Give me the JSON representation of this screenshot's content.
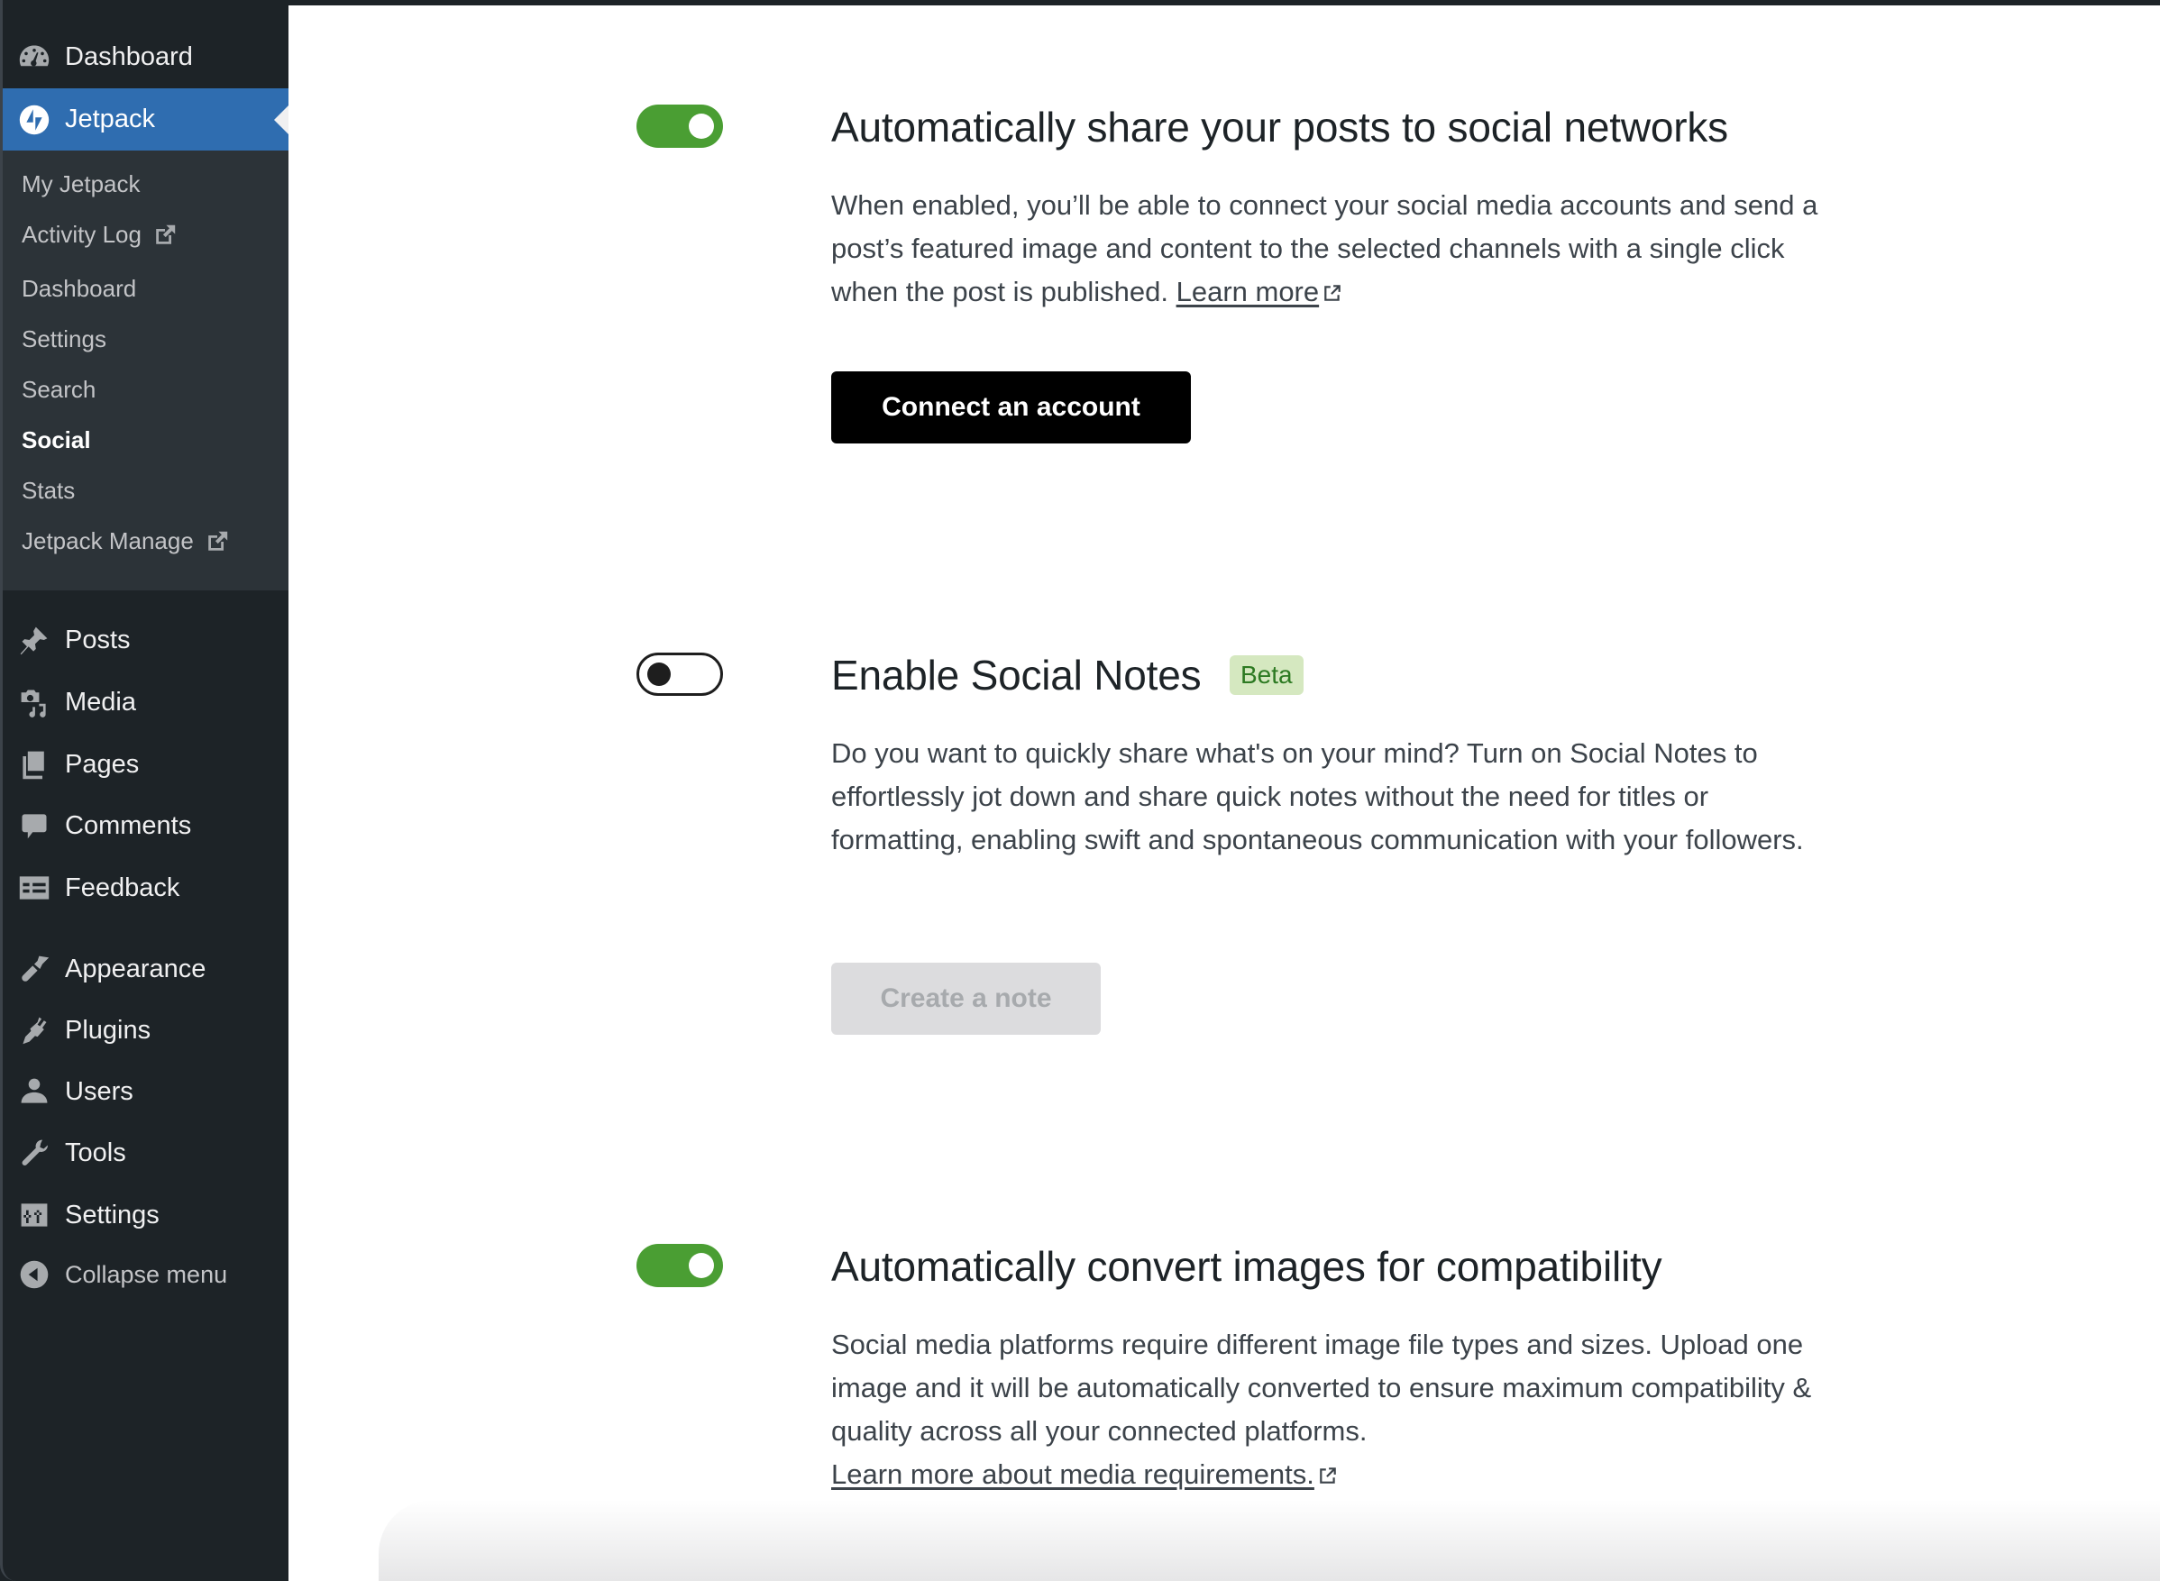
{
  "sidebar": {
    "top_items": [
      {
        "label": "Dashboard",
        "icon": "dashboard-icon"
      },
      {
        "label": "Jetpack",
        "icon": "jetpack-icon",
        "active": true
      }
    ],
    "submenu": [
      {
        "label": "My Jetpack"
      },
      {
        "label": "Activity Log",
        "external": true
      },
      {
        "label": "Dashboard"
      },
      {
        "label": "Settings"
      },
      {
        "label": "Search"
      },
      {
        "label": "Social",
        "current": true
      },
      {
        "label": "Stats"
      },
      {
        "label": "Jetpack Manage",
        "external": true
      }
    ],
    "items": [
      {
        "label": "Posts",
        "icon": "pin-icon"
      },
      {
        "label": "Media",
        "icon": "media-icon"
      },
      {
        "label": "Pages",
        "icon": "pages-icon"
      },
      {
        "label": "Comments",
        "icon": "comment-icon"
      },
      {
        "label": "Feedback",
        "icon": "feedback-icon"
      },
      {
        "label": "Appearance",
        "icon": "paintbrush-icon"
      },
      {
        "label": "Plugins",
        "icon": "plug-icon"
      },
      {
        "label": "Users",
        "icon": "user-icon"
      },
      {
        "label": "Tools",
        "icon": "wrench-icon"
      },
      {
        "label": "Settings",
        "icon": "settings-icon"
      }
    ],
    "collapse_label": "Collapse menu"
  },
  "sections": {
    "share": {
      "toggle_on": true,
      "title": "Automatically share your posts to social networks",
      "description": "When enabled, you’ll be able to connect your social media accounts and send a post’s featured image and content to the selected channels with a single click when the post is published.",
      "link_label": "Learn more",
      "button_label": "Connect an account"
    },
    "notes": {
      "toggle_on": false,
      "title": "Enable Social Notes",
      "badge": "Beta",
      "description": "Do you want to quickly share what's on your mind? Turn on Social Notes to effortlessly jot down and share quick notes without the need for titles or formatting, enabling swift and spontaneous communication with your followers.",
      "button_label": "Create a note"
    },
    "convert": {
      "toggle_on": true,
      "title": "Automatically convert images for compatibility",
      "description": "Social media platforms require different image file types and sizes. Upload one image and it will be automatically converted to ensure maximum compatibility & quality across all your connected platforms.",
      "link_label": "Learn more about media requirements."
    }
  },
  "colors": {
    "toggle_on": "#4a9e33",
    "sidebar_bg": "#1d2327",
    "submenu_bg": "#2c3338",
    "active_item": "#2f6db0",
    "badge_bg": "#d5e8c0",
    "badge_text": "#2d7a22"
  }
}
